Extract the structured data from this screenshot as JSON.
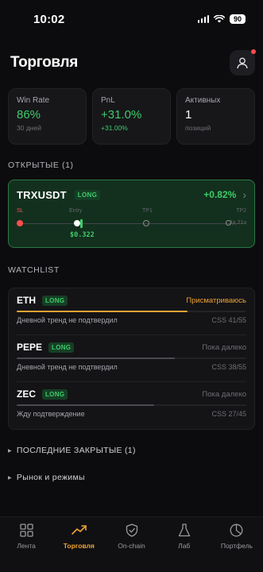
{
  "status_bar": {
    "time": "10:02",
    "battery": "90"
  },
  "header": {
    "title": "Торговля"
  },
  "stats": [
    {
      "label": "Win Rate",
      "value": "86%",
      "sub": "30 дней"
    },
    {
      "label": "PnL",
      "value": "+31.0%",
      "sub": "+31.00%"
    },
    {
      "label": "Активных",
      "value": "1",
      "sub": "позиций"
    }
  ],
  "open_section": {
    "title": "ОТКРЫТЫЕ (1)"
  },
  "position": {
    "symbol": "TRXUSDT",
    "side": "LONG",
    "pnl": "+0.82%",
    "labels": {
      "sl": "SL",
      "entry": "Entry",
      "tp1": "TP1",
      "tp2": "TP2",
      "time": "3д 21ч"
    },
    "current_price": "$0.322",
    "progress": 0.24,
    "colors": {
      "sl": "#ff4d4d",
      "current": "#3ecb6a"
    }
  },
  "watchlist": {
    "title": "WATCHLIST",
    "items": [
      {
        "symbol": "ETH",
        "badge": "LONG",
        "status": "Присматриваюсь",
        "note": "Дневной тренд не подтвердил",
        "css": "CSS 41/55",
        "progress": 0.745,
        "bar_color": "#f0a233"
      },
      {
        "symbol": "PEPE",
        "badge": "LONG",
        "status": "Пока далеко",
        "note": "Дневной тренд не подтвердил",
        "css": "CSS 38/55",
        "progress": 0.69,
        "bar_color": "#4a4a50"
      },
      {
        "symbol": "ZEC",
        "badge": "LONG",
        "status": "Пока далеко",
        "note": "Жду подтверждение",
        "css": "CSS 27/45",
        "progress": 0.6,
        "bar_color": "#4a4a50"
      }
    ]
  },
  "collapsed": {
    "recent": "ПОСЛЕДНИЕ ЗАКРЫТЫЕ (1)",
    "market": "Рынок и режимы"
  },
  "tabbar": [
    {
      "label": "Лента",
      "icon": "grid-icon"
    },
    {
      "label": "Торговля",
      "icon": "trend-icon",
      "active": true
    },
    {
      "label": "On-chain",
      "icon": "shield-icon"
    },
    {
      "label": "Лаб",
      "icon": "flask-icon"
    },
    {
      "label": "Портфель",
      "icon": "pie-icon"
    }
  ]
}
